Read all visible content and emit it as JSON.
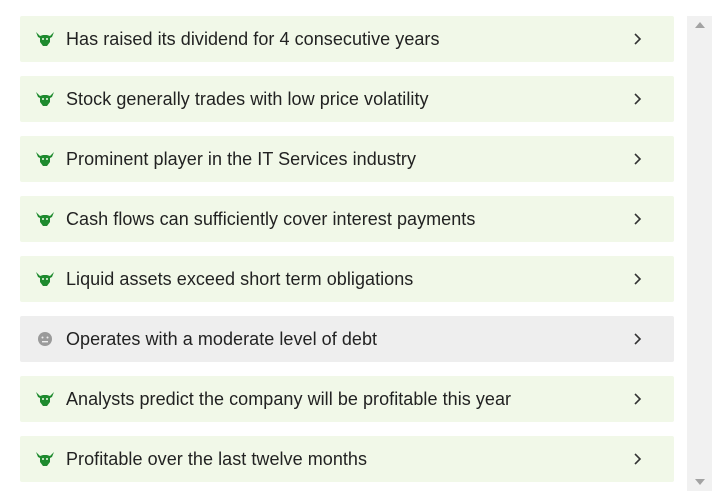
{
  "checklist": {
    "items": [
      {
        "label": "Has raised its dividend for 4 consecutive years",
        "status": "bull-icon"
      },
      {
        "label": "Stock generally trades with low price volatility",
        "status": "bull-icon"
      },
      {
        "label": "Prominent player in the IT Services industry",
        "status": "bull-icon"
      },
      {
        "label": "Cash flows can sufficiently cover interest payments",
        "status": "bull-icon"
      },
      {
        "label": "Liquid assets exceed short term obligations",
        "status": "bull-icon"
      },
      {
        "label": "Operates with a moderate level of debt",
        "status": "neutral-face-icon"
      },
      {
        "label": "Analysts predict the company will be profitable this year",
        "status": "bull-icon"
      },
      {
        "label": "Profitable over the last twelve months",
        "status": "bull-icon"
      }
    ]
  },
  "colors": {
    "bull_bg": "#f1f8e8",
    "neutral_bg": "#eeeeee",
    "bull_icon": "#1e8a2e",
    "neutral_icon": "#9a9a9a"
  }
}
